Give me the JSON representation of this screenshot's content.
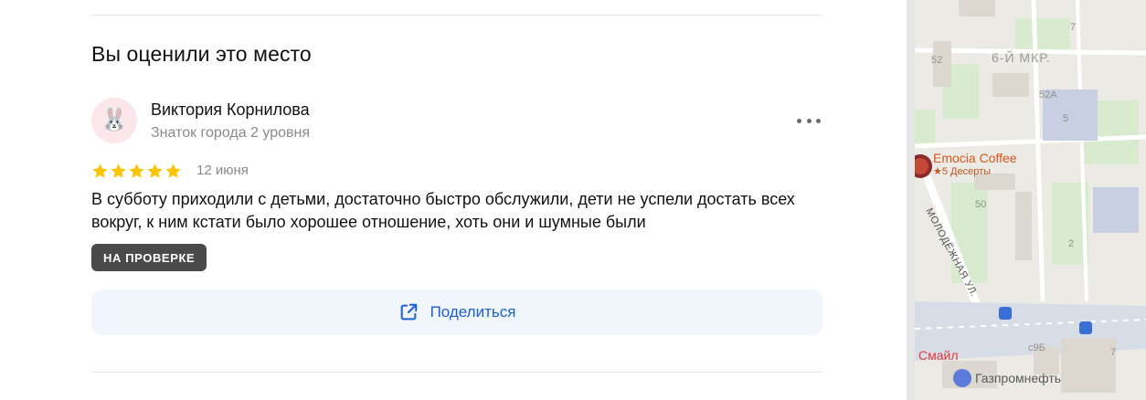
{
  "section_title": "Вы оценили это место",
  "review": {
    "author_name": "Виктория Корнилова",
    "author_level": "Знаток города 2 уровня",
    "avatar_emoji": "🐰",
    "rating": 5,
    "date": "12 июня",
    "text": "В субботу приходили с детьми, достаточно быстро обслужили, дети не успели достать всех вокруг, к ним кстати было хорошее отношение, хоть они и шумные были",
    "status_badge": "НА ПРОВЕРКЕ"
  },
  "actions": {
    "share_label": "Поделиться",
    "more_icon": "more-dots-icon",
    "share_icon": "share-external-icon"
  },
  "colors": {
    "star": "#fcc400",
    "badge_bg": "#4a4a4a",
    "share_bg": "#f1f5fc",
    "share_text": "#1a5fd6",
    "poi": "#d9561d",
    "smile": "#e03a3a"
  },
  "map": {
    "district": "6-Й МКР.",
    "building_numbers": [
      "52",
      "52А",
      "5",
      "7",
      "50",
      "2",
      "с9Б",
      "7"
    ],
    "poi_name": "Emocia Coffee",
    "poi_sub": "★5 Десерты",
    "street": "МОЛОДЁЖНАЯ УЛ.",
    "poi_smile": "Смайл",
    "poi_gas": "Газпромнефть"
  }
}
